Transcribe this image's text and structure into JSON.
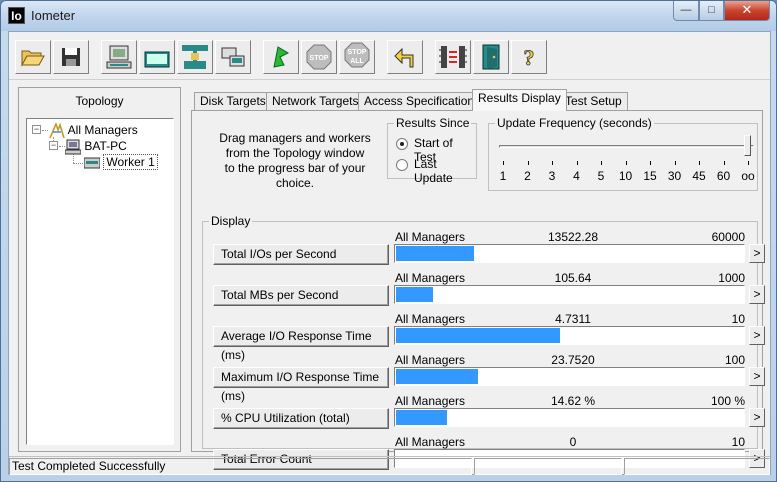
{
  "window": {
    "title": "Iometer",
    "icon_text": "Io"
  },
  "toolbar": {
    "buttons": [
      {
        "name": "open-config",
        "icon": "folder-open-icon"
      },
      {
        "name": "save-config",
        "icon": "floppy-disk-icon"
      },
      {
        "name": "start-disk-worker",
        "icon": "computer-icon"
      },
      {
        "name": "start-network-worker",
        "icon": "network-worker-icon"
      },
      {
        "name": "add-network-worker",
        "icon": "network-pipe-icon"
      },
      {
        "name": "copy-worker",
        "icon": "duplicate-worker-icon"
      },
      {
        "name": "start-tests",
        "icon": "green-flag-icon"
      },
      {
        "name": "stop-test",
        "icon": "stop-sign-icon",
        "label": "STOP"
      },
      {
        "name": "stop-all",
        "icon": "stop-all-icon",
        "label": "STOP",
        "sublabel": "ALL"
      },
      {
        "name": "reset-workers",
        "icon": "reset-arrow-icon"
      },
      {
        "name": "disconnect-managers",
        "icon": "disconnect-icon"
      },
      {
        "name": "exit",
        "icon": "exit-door-icon"
      },
      {
        "name": "about",
        "icon": "help-question-icon",
        "label": "?"
      }
    ]
  },
  "topology": {
    "title": "Topology",
    "root": "All Managers",
    "manager": "BAT-PC",
    "worker": "Worker 1"
  },
  "tabs": [
    {
      "label": "Disk Targets",
      "active": false
    },
    {
      "label": "Network Targets",
      "active": false
    },
    {
      "label": "Access Specifications",
      "active": false
    },
    {
      "label": "Results Display",
      "active": true
    },
    {
      "label": "Test Setup",
      "active": false
    }
  ],
  "results": {
    "drag_text_1": "Drag managers and workers",
    "drag_text_2": "from the Topology window",
    "drag_text_3": "to the progress bar of your choice.",
    "since_label": "Results Since",
    "since_options": [
      "Start of Test",
      "Last Update"
    ],
    "since_selected": "Start of Test",
    "frequency_label": "Update Frequency (seconds)",
    "frequency_ticks": [
      "1",
      "2",
      "3",
      "4",
      "5",
      "10",
      "15",
      "30",
      "45",
      "60",
      "oo"
    ],
    "frequency_selected": "oo",
    "display_label": "Display",
    "metrics": [
      {
        "label": "Total I/Os per Second",
        "manager": "All Managers",
        "value": "13522.28",
        "max": "60000",
        "fill": 0.2254
      },
      {
        "label": "Total MBs per Second",
        "manager": "All Managers",
        "value": "105.64",
        "max": "1000",
        "fill": 0.106
      },
      {
        "label": "Average I/O Response Time (ms)",
        "manager": "All Managers",
        "value": "4.7311",
        "max": "10",
        "fill": 0.4731
      },
      {
        "label": "Maximum I/O Response Time (ms)",
        "manager": "All Managers",
        "value": "23.7520",
        "max": "100",
        "fill": 0.2375
      },
      {
        "label": "% CPU Utilization (total)",
        "manager": "All Managers",
        "value": "14.62 %",
        "max": "100 %",
        "fill": 0.1462
      },
      {
        "label": "Total Error Count",
        "manager": "All Managers",
        "value": "0",
        "max": "10",
        "fill": 0
      }
    ],
    "arrow": ">"
  },
  "status": {
    "text": "Test Completed Successfully"
  },
  "colors": {
    "bar": "#3399ff",
    "close_button": "#c9452d"
  }
}
